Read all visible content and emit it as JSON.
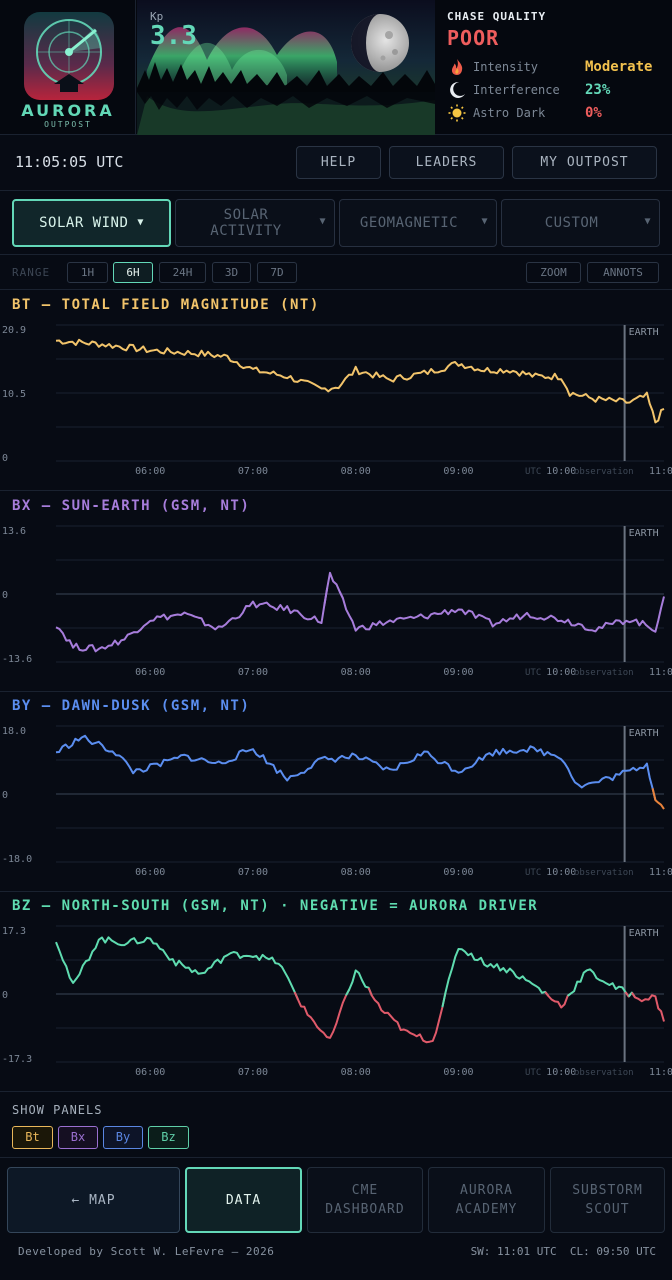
{
  "logo": {
    "title": "AURORA",
    "subtitle": "OUTPOST"
  },
  "kp": {
    "label": "Kp",
    "value": "3.3"
  },
  "chase": {
    "title": "CHASE QUALITY",
    "value": "POOR",
    "rows": [
      {
        "label": "Intensity",
        "value": "Moderate",
        "icon": "flame-icon",
        "color": "#f2c14e"
      },
      {
        "label": "Interference",
        "value": "23%",
        "icon": "moon-crescent-icon",
        "color": "#63d8b8"
      },
      {
        "label": "Astro Dark",
        "value": "0%",
        "icon": "sun-icon",
        "color": "#ee5d5d"
      }
    ]
  },
  "clock": "11:05:05 UTC",
  "topbar": {
    "help": "HELP",
    "leaders": "LEADERS",
    "outpost": "MY OUTPOST"
  },
  "categories": [
    {
      "label": "SOLAR WIND",
      "arrow": "▼",
      "active": true
    },
    {
      "label": "SOLAR\nACTIVITY",
      "arrow": "▼"
    },
    {
      "label": "GEOMAGNETIC",
      "arrow": "▼"
    },
    {
      "label": "CUSTOM",
      "arrow": "▼"
    }
  ],
  "range": {
    "label": "RANGE",
    "options": [
      "1H",
      "6H",
      "24H",
      "3D",
      "7D"
    ],
    "selected": "6H",
    "zoom": "ZOOM",
    "annots": "ANNOTS"
  },
  "panels": [
    {
      "title": "BT — TOTAL FIELD MAGNITUDE (NT)",
      "color": "#f2c46b"
    },
    {
      "title": "BX — SUN-EARTH (GSM, NT)",
      "color": "#a77ddb"
    },
    {
      "title": "BY — DAWN-DUSK (GSM, NT)",
      "color": "#5b8ef0"
    },
    {
      "title": "BZ — NORTH-SOUTH (GSM, NT) · NEGATIVE = AURORA DRIVER",
      "color": "#5fdcb0"
    }
  ],
  "chart_marker": {
    "label": "EARTH",
    "time": "10:37",
    "note": "observation",
    "utc": "UTC"
  },
  "chart_data": [
    {
      "type": "line",
      "title": "BT — TOTAL FIELD MAGNITUDE (NT)",
      "ylim": [
        0,
        20.9
      ],
      "yticks": [
        "20.9",
        "10.5",
        "0"
      ],
      "xticks": [
        "06:00",
        "07:00",
        "08:00",
        "09:00",
        "10:00",
        "11:00"
      ],
      "series": [
        {
          "x": [
            "05:05",
            "05:30",
            "06:00",
            "06:30",
            "06:45",
            "07:00",
            "07:20",
            "07:40",
            "07:50",
            "08:00",
            "08:20",
            "08:40",
            "09:00",
            "09:15",
            "09:30",
            "09:45",
            "10:00",
            "10:05",
            "10:20",
            "10:40",
            "10:50",
            "10:55",
            "11:00"
          ],
          "y": [
            18.5,
            18.0,
            17.0,
            16.5,
            16.0,
            14.0,
            13.0,
            11.0,
            11.5,
            14.0,
            12.5,
            13.5,
            15.0,
            14.0,
            14.0,
            13.0,
            13.0,
            10.5,
            9.5,
            9.0,
            10.0,
            6.0,
            8.0
          ],
          "color": "#f2c46b"
        }
      ]
    },
    {
      "type": "line",
      "title": "BX — SUN-EARTH (GSM, NT)",
      "ylim": [
        -13.6,
        13.6
      ],
      "yticks": [
        "13.6",
        "0",
        "-13.6"
      ],
      "xticks": [
        "06:00",
        "07:00",
        "08:00",
        "09:00",
        "10:00",
        "11:00"
      ],
      "series": [
        {
          "x": [
            "05:05",
            "05:15",
            "05:30",
            "05:45",
            "06:00",
            "06:20",
            "06:40",
            "07:00",
            "07:20",
            "07:40",
            "07:45",
            "08:00",
            "08:20",
            "08:40",
            "09:00",
            "09:20",
            "09:40",
            "10:00",
            "10:20",
            "10:40",
            "10:55",
            "11:00"
          ],
          "y": [
            -6.0,
            -10.5,
            -11.0,
            -9.0,
            -5.0,
            -4.0,
            -7.0,
            -2.0,
            -3.0,
            -5.5,
            4.0,
            -7.0,
            -5.5,
            -4.5,
            -3.0,
            -6.0,
            -4.0,
            -5.0,
            -7.0,
            -5.0,
            -7.0,
            -0.5
          ],
          "color": "#a77ddb"
        }
      ]
    },
    {
      "type": "line",
      "title": "BY — DAWN-DUSK (GSM, NT)",
      "ylim": [
        -18.0,
        18.0
      ],
      "yticks": [
        "18.0",
        "0",
        "-18.0"
      ],
      "xticks": [
        "06:00",
        "07:00",
        "08:00",
        "09:00",
        "10:00",
        "11:00"
      ],
      "series": [
        {
          "x": [
            "05:05",
            "05:20",
            "05:40",
            "05:50",
            "06:00",
            "06:20",
            "06:40",
            "07:00",
            "07:20",
            "07:40",
            "08:00",
            "08:20",
            "08:40",
            "09:00",
            "09:20",
            "09:40",
            "10:00",
            "10:10",
            "10:20",
            "10:40",
            "10:50",
            "10:55",
            "11:00"
          ],
          "y": [
            11.0,
            15.0,
            11.0,
            6.0,
            7.0,
            10.0,
            8.0,
            12.0,
            4.0,
            9.0,
            10.0,
            6.0,
            11.0,
            6.0,
            11.0,
            12.0,
            10.0,
            2.0,
            3.0,
            6.0,
            8.0,
            -1.0,
            -4.0
          ],
          "color": "#5b8ef0",
          "negative_color": "#e8823a"
        }
      ]
    },
    {
      "type": "line",
      "title": "BZ — NORTH-SOUTH (GSM, NT) · NEGATIVE = AURORA DRIVER",
      "ylim": [
        -17.3,
        17.3
      ],
      "yticks": [
        "17.3",
        "0",
        "-17.3"
      ],
      "xticks": [
        "06:00",
        "07:00",
        "08:00",
        "09:00",
        "10:00",
        "11:00"
      ],
      "series": [
        {
          "x": [
            "05:05",
            "05:15",
            "05:30",
            "05:45",
            "06:00",
            "06:15",
            "06:30",
            "06:45",
            "07:00",
            "07:15",
            "07:30",
            "07:45",
            "08:00",
            "08:15",
            "08:30",
            "08:45",
            "09:00",
            "09:15",
            "09:30",
            "09:45",
            "10:00",
            "10:15",
            "10:30",
            "10:45",
            "10:55",
            "11:00"
          ],
          "y": [
            14.0,
            2.0,
            14.0,
            13.0,
            14.0,
            8.0,
            5.0,
            10.0,
            10.0,
            8.0,
            -4.0,
            -12.0,
            6.0,
            -4.0,
            -10.0,
            -12.0,
            12.0,
            8.0,
            6.0,
            2.0,
            -3.0,
            6.0,
            2.0,
            -1.0,
            -1.0,
            -7.0
          ],
          "color": "#5fdcb0",
          "negative_color": "#e05a6a"
        }
      ]
    }
  ],
  "show_panels": {
    "label": "SHOW PANELS",
    "chips": [
      {
        "label": "Bt",
        "color": "#e9b75a"
      },
      {
        "label": "Bx",
        "color": "#9a6fd0"
      },
      {
        "label": "By",
        "color": "#5a86e2"
      },
      {
        "label": "Bz",
        "color": "#5fcfa8"
      }
    ]
  },
  "nav": [
    {
      "label": "← MAP"
    },
    {
      "label": "DATA",
      "active": true
    },
    {
      "label": "CME\nDASHBOARD"
    },
    {
      "label": "AURORA\nACADEMY"
    },
    {
      "label": "SUBSTORM\nSCOUT"
    }
  ],
  "footer": {
    "credit": "Developed by Scott W. LeFevre — 2026",
    "times": "SW: 11:01 UTC  CL: 09:50 UTC"
  }
}
